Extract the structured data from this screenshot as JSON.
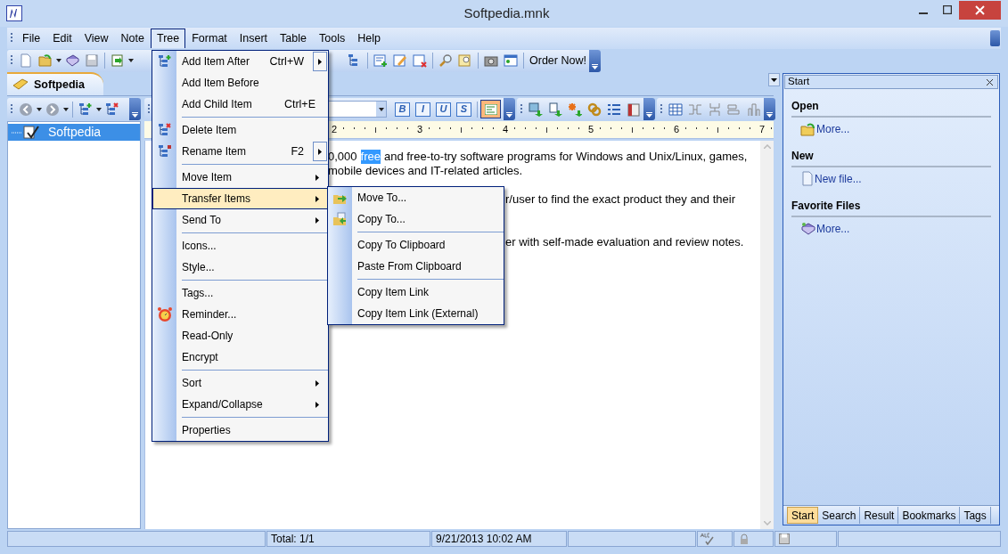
{
  "window": {
    "title": "Softpedia.mnk"
  },
  "menu_bar": [
    {
      "label": "File",
      "selected": false
    },
    {
      "label": "Edit",
      "selected": false
    },
    {
      "label": "View",
      "selected": false
    },
    {
      "label": "Note",
      "selected": false
    },
    {
      "label": "Tree",
      "selected": true
    },
    {
      "label": "Format",
      "selected": false
    },
    {
      "label": "Insert",
      "selected": false
    },
    {
      "label": "Table",
      "selected": false
    },
    {
      "label": "Tools",
      "selected": false
    },
    {
      "label": "Help",
      "selected": false
    }
  ],
  "toolbar": {
    "order_button": "Order Now!"
  },
  "document_tabs": [
    {
      "label": "Softpedia",
      "selected": true
    }
  ],
  "tree": [
    {
      "label": "Softpedia",
      "selected": true
    }
  ],
  "format_toolbar": {
    "buttons": [
      {
        "label": "B",
        "on": false
      },
      {
        "label": "I",
        "on": false
      },
      {
        "label": "U",
        "on": false
      },
      {
        "label": "S",
        "on": false
      }
    ],
    "align_left_on": true
  },
  "ruler": [
    "2",
    "3",
    "4",
    "5",
    "6",
    "7"
  ],
  "editor": {
    "lines_beside_menu": [
      {
        "kind": "selection",
        "before": "0,000",
        "selected": "free",
        "after": "and free-to-try software programs for Windows and Unix/Linux, games,"
      },
      {
        "kind": "plain",
        "text": "mobile devices and IT-related articles."
      }
    ],
    "lines_beside_submenu": [
      {
        "kind": "plain",
        "text": "r/user to find the exact product they and their"
      },
      {
        "kind": "gap"
      },
      {
        "kind": "plain",
        "text": "er with self-made evaluation and review notes."
      }
    ]
  },
  "tree_menu": {
    "items": [
      {
        "kind": "item",
        "label": "Add Item After",
        "shortcut": "Ctrl+W",
        "has_submenu": true,
        "split_button": true,
        "highlighted": false
      },
      {
        "kind": "item",
        "label": "Add Item Before",
        "highlighted": false
      },
      {
        "kind": "item",
        "label": "Add Child Item",
        "shortcut": "Ctrl+E",
        "highlighted": false
      },
      {
        "kind": "separator"
      },
      {
        "kind": "item",
        "label": "Delete Item",
        "highlighted": false
      },
      {
        "kind": "item",
        "label": "Rename Item",
        "shortcut": "F2",
        "has_submenu": true,
        "split_button": true,
        "highlighted": false
      },
      {
        "kind": "separator"
      },
      {
        "kind": "item",
        "label": "Move Item",
        "has_submenu": true,
        "split_button": false,
        "highlighted": false
      },
      {
        "kind": "item",
        "label": "Transfer Items",
        "has_submenu": true,
        "split_button": false,
        "highlighted": true
      },
      {
        "kind": "item",
        "label": "Send To",
        "has_submenu": true,
        "split_button": false,
        "highlighted": false
      },
      {
        "kind": "separator"
      },
      {
        "kind": "item",
        "label": "Icons...",
        "highlighted": false
      },
      {
        "kind": "item",
        "label": "Style...",
        "highlighted": false
      },
      {
        "kind": "separator"
      },
      {
        "kind": "item",
        "label": "Tags...",
        "highlighted": false
      },
      {
        "kind": "item",
        "label": "Reminder...",
        "highlighted": false
      },
      {
        "kind": "item",
        "label": "Read-Only",
        "highlighted": false
      },
      {
        "kind": "item",
        "label": "Encrypt",
        "highlighted": false
      },
      {
        "kind": "separator"
      },
      {
        "kind": "item",
        "label": "Sort",
        "has_submenu": true,
        "split_button": false,
        "highlighted": false
      },
      {
        "kind": "item",
        "label": "Expand/Collapse",
        "has_submenu": true,
        "split_button": false,
        "highlighted": false
      },
      {
        "kind": "separator"
      },
      {
        "kind": "item",
        "label": "Properties",
        "highlighted": false
      }
    ]
  },
  "transfer_submenu": {
    "items": [
      {
        "kind": "item",
        "label": "Move To...",
        "highlighted": false
      },
      {
        "kind": "item",
        "label": "Copy To...",
        "highlighted": false
      },
      {
        "kind": "separator"
      },
      {
        "kind": "item",
        "label": "Copy To Clipboard",
        "highlighted": false
      },
      {
        "kind": "item",
        "label": "Paste From Clipboard",
        "highlighted": false
      },
      {
        "kind": "separator"
      },
      {
        "kind": "item",
        "label": "Copy Item Link",
        "highlighted": false
      },
      {
        "kind": "item",
        "label": "Copy Item Link (External)",
        "highlighted": false
      }
    ]
  },
  "right_panel": {
    "title": "Start",
    "sections": [
      {
        "heading": "Open",
        "link": "More..."
      },
      {
        "heading": "New",
        "link": "New file..."
      },
      {
        "heading": "Favorite Files",
        "link": "More..."
      }
    ],
    "tabs": [
      {
        "label": "Start",
        "selected": true
      },
      {
        "label": "Search",
        "selected": false
      },
      {
        "label": "Result",
        "selected": false
      },
      {
        "label": "Bookmarks",
        "selected": false
      },
      {
        "label": "Tags",
        "selected": false
      }
    ]
  },
  "status_bar": {
    "total": "Total: 1/1",
    "date": "9/21/2013 10:02 AM"
  }
}
